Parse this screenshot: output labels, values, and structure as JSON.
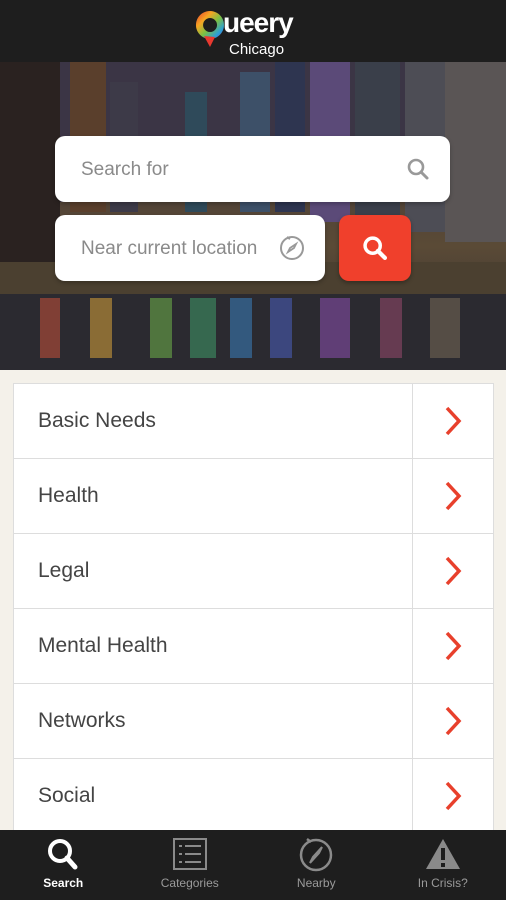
{
  "header": {
    "logo_word": "ueery",
    "logo_city": "Chicago"
  },
  "search": {
    "placeholder": "Search for",
    "location_placeholder": "Near current location",
    "search_icon": "search-icon",
    "location_icon": "compass-icon",
    "submit_icon": "search-icon"
  },
  "categories": [
    {
      "label": "Basic Needs"
    },
    {
      "label": "Health"
    },
    {
      "label": "Legal"
    },
    {
      "label": "Mental Health"
    },
    {
      "label": "Networks"
    },
    {
      "label": "Social"
    }
  ],
  "nav": {
    "items": [
      {
        "label": "Search",
        "icon": "search-icon",
        "active": true
      },
      {
        "label": "Categories",
        "icon": "list-icon",
        "active": false
      },
      {
        "label": "Nearby",
        "icon": "compass-icon",
        "active": false
      },
      {
        "label": "In Crisis?",
        "icon": "warning-icon",
        "active": false
      }
    ]
  },
  "colors": {
    "accent": "#f0402c",
    "header_bg": "#1e1e1e",
    "page_bg": "#f4f1ea"
  }
}
